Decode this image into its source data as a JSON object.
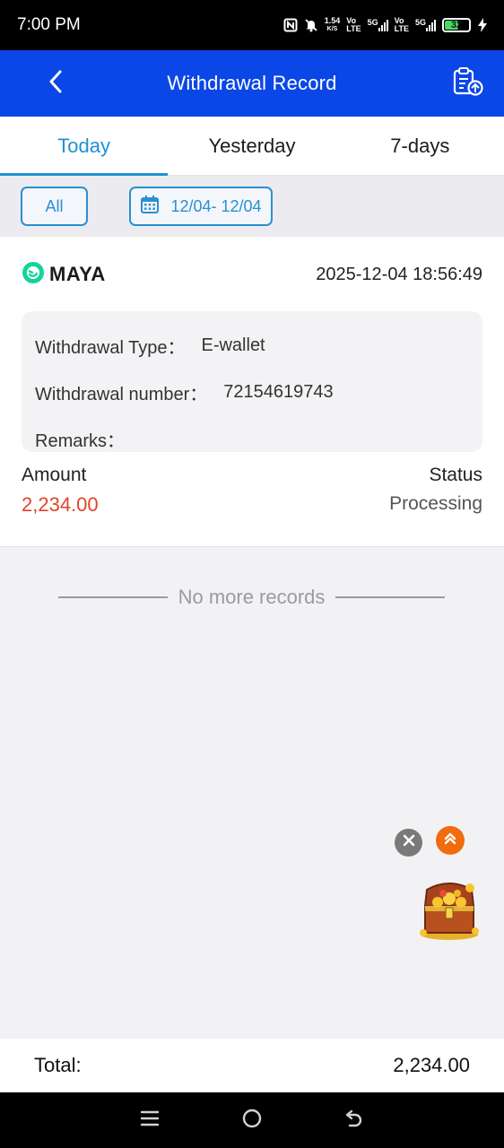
{
  "status_bar": {
    "time": "7:00 PM",
    "speed_value": "1.54",
    "speed_unit": "K/S",
    "net1_top": "Vo",
    "net1_bottom": "LTE",
    "net1_gen": "5G",
    "net2_top": "Vo",
    "net2_bottom": "LTE",
    "net2_gen": "5G",
    "battery": "32",
    "icons": [
      "nfc-icon",
      "mute-icon",
      "signal-icon",
      "battery-icon",
      "charging-icon"
    ]
  },
  "header": {
    "title": "Withdrawal Record",
    "back_icon": "chevron-left-icon",
    "action_icon": "clipboard-upload-icon",
    "color": "#0b47e6"
  },
  "tabs": [
    {
      "label": "Today",
      "active": true
    },
    {
      "label": "Yesterday",
      "active": false
    },
    {
      "label": "7-days",
      "active": false
    }
  ],
  "filters": {
    "type_label": "All",
    "date_range": "12/04- 12/04",
    "accent": "#2b8fd1"
  },
  "record": {
    "brand": "MAYA",
    "datetime": "2025-12-04 18:56:49",
    "details": [
      {
        "label": "Withdrawal Type：",
        "value": "E-wallet"
      },
      {
        "label": "Withdrawal number：",
        "value": "72154619743"
      },
      {
        "label": "Remarks：",
        "value": ""
      }
    ],
    "amount_label": "Amount",
    "amount_value": "2,234.00",
    "status_label": "Status",
    "status_value": "Processing",
    "amount_color": "#e0432a"
  },
  "footer_note": "No more records",
  "total": {
    "label": "Total:",
    "value": "2,234.00"
  },
  "nav": {
    "icons": [
      "menu-icon",
      "home-icon",
      "back-icon"
    ]
  }
}
